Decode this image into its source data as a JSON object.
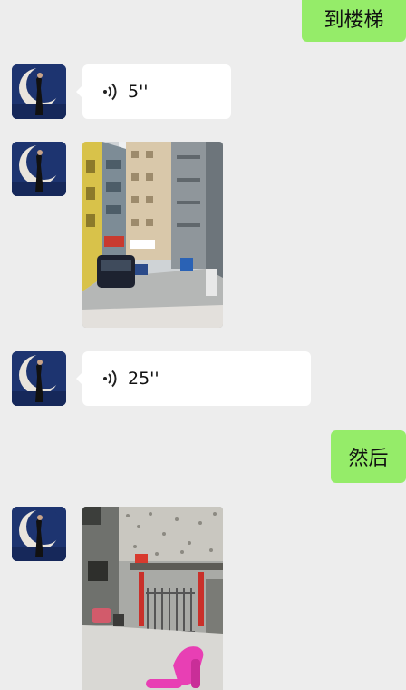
{
  "messages": [
    {
      "side": "outgoing",
      "type": "text",
      "text": "到楼梯"
    },
    {
      "side": "incoming",
      "type": "voice",
      "duration": "5''",
      "avatar_icon": "contact-avatar"
    },
    {
      "side": "incoming",
      "type": "image",
      "content": "street-alley-photo",
      "avatar_icon": "contact-avatar"
    },
    {
      "side": "incoming",
      "type": "voice",
      "duration": "25''",
      "avatar_icon": "contact-avatar"
    },
    {
      "side": "outgoing",
      "type": "text",
      "text": "然后"
    },
    {
      "side": "incoming",
      "type": "image",
      "content": "building-entrance-photo",
      "avatar_icon": "contact-avatar"
    }
  ],
  "colors": {
    "background": "#ededed",
    "outgoing_bubble": "#95ec69",
    "incoming_bubble": "#ffffff"
  }
}
